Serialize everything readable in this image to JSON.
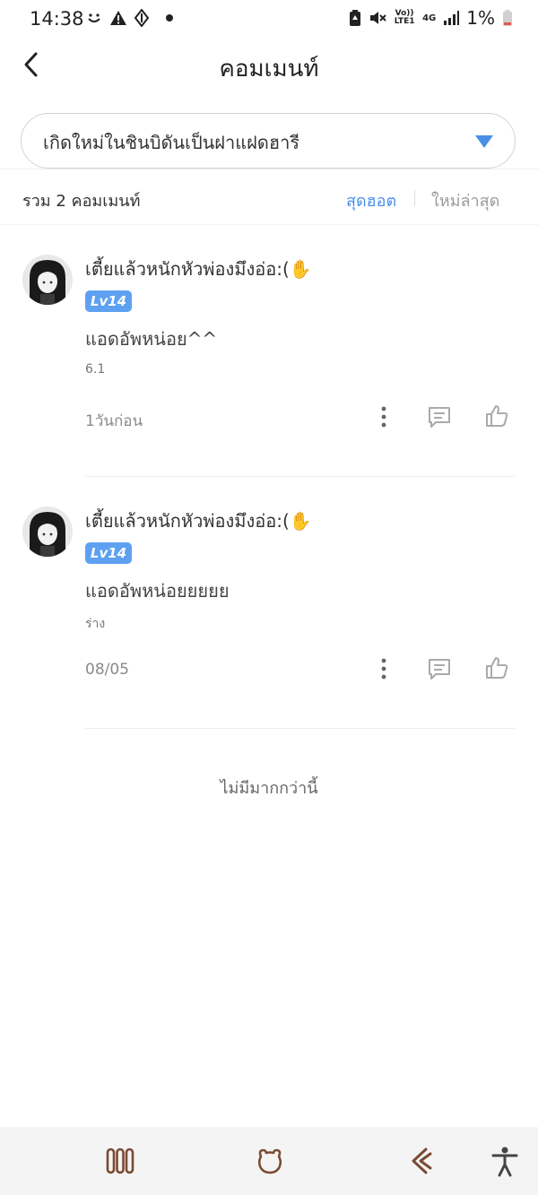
{
  "status_bar": {
    "time": "14:38",
    "battery": "1%",
    "left_icons": [
      "emoji-icon",
      "warning-icon",
      "diamond-icon",
      "dot-icon"
    ],
    "right_icons": [
      "battery-saver-icon",
      "mute-icon",
      "volte-icon",
      "4g-icon",
      "signal-icon",
      "battery-icon"
    ],
    "volte_label": "Vo)) LTE1",
    "network_label": "4G"
  },
  "header": {
    "title": "คอมเมนท์",
    "back_icon": "chevron-left-icon"
  },
  "novel_selector": {
    "selected": "เกิดใหม่ในชินบิดันเป็นฝาแฝดฮารี",
    "accent": "#4a8fe7"
  },
  "summary": {
    "count_label": "รวม 2 คอมเมนท์",
    "sort_hot": "สุดฮอต",
    "sort_new": "ใหม่ล่าสุด",
    "active_sort_color": "#4a8fe7"
  },
  "comments": [
    {
      "username": "เตี้ยแล้วหนักหัวพ่องมึงอ่อ:(✋",
      "level": "Lv14",
      "text": "แอดอัพหน่อย^^",
      "chapter": "6.1",
      "time": "1วันก่อน"
    },
    {
      "username": "เตี้ยแล้วหนักหัวพ่องมึงอ่อ:(✋",
      "level": "Lv14",
      "text": "แอดอัพหน่อยยยยย",
      "chapter": "ร่าง",
      "time": "08/05"
    }
  ],
  "footer_text": "ไม่มีมากกว่านี้",
  "nav_bar": {
    "icons": [
      "recent-apps-icon",
      "home-icon",
      "back-icon",
      "accessibility-icon"
    ]
  }
}
